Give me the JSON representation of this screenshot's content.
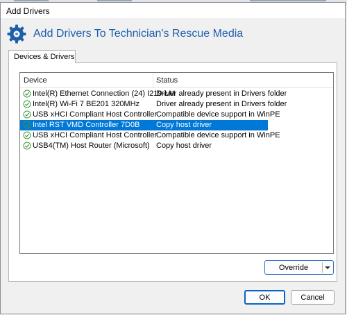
{
  "window": {
    "title": "Add Drivers"
  },
  "header": {
    "heading": "Add Drivers To Technician's Rescue Media"
  },
  "tabs": [
    {
      "label": "Devices & Drivers"
    }
  ],
  "list": {
    "columns": {
      "device": "Device",
      "status": "Status"
    },
    "rows": [
      {
        "device": "Intel(R) Ethernet Connection (24) I219-LM",
        "status": "Driver already present in Drivers folder",
        "selected": false
      },
      {
        "device": "Intel(R) Wi-Fi 7 BE201 320MHz",
        "status": "Driver already present in Drivers folder",
        "selected": false
      },
      {
        "device": "USB xHCI Compliant Host Controller",
        "status": "Compatible device support in WinPE",
        "selected": false
      },
      {
        "device": "Intel RST VMD Controller 7D0B",
        "status": "Copy host driver",
        "selected": true
      },
      {
        "device": "USB xHCI Compliant Host Controller",
        "status": "Compatible device support in WinPE",
        "selected": false
      },
      {
        "device": "USB4(TM) Host Router (Microsoft)",
        "status": "Copy host driver",
        "selected": false
      }
    ]
  },
  "buttons": {
    "override": "Override",
    "ok": "OK",
    "cancel": "Cancel"
  },
  "colors": {
    "accent": "#1c5fae",
    "selection": "#0078d7",
    "check": "#3c9a3c"
  },
  "icons": {
    "header": "gear-icon",
    "row": "check-circle-icon",
    "split": "chevron-down-icon"
  }
}
